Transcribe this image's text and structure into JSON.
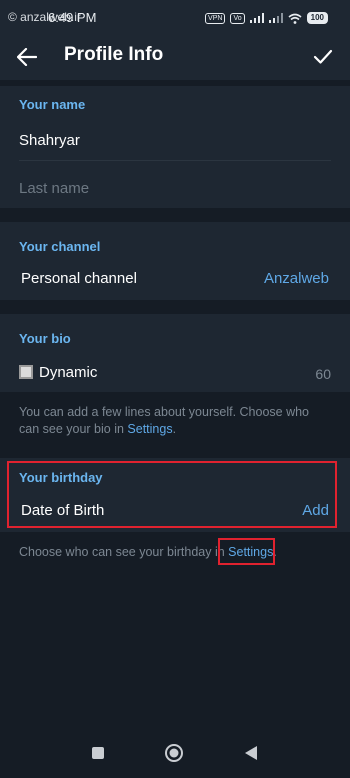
{
  "status_bar": {
    "watermark": "© anzalweb.ir",
    "time": "6:49 PM",
    "vpn": "VPN",
    "volte": "Vo",
    "battery": "100"
  },
  "top_bar": {
    "title": "Profile Info"
  },
  "name_section": {
    "header": "Your name",
    "first_name": "Shahryar",
    "last_name_placeholder": "Last name"
  },
  "channel_section": {
    "header": "Your channel",
    "label": "Personal channel",
    "value": "Anzalweb"
  },
  "bio_section": {
    "header": "Your bio",
    "bio_text": "Dynamic",
    "counter": "60",
    "hint_prefix": "You can add a few lines about yourself. Choose who can see your bio in ",
    "hint_link": "Settings",
    "hint_suffix": "."
  },
  "birthday_section": {
    "header": "Your birthday",
    "label": "Date of Birth",
    "action": "Add",
    "hint_prefix": "Choose who can see your birthday in ",
    "hint_link": "Settings",
    "hint_suffix": "."
  },
  "colors": {
    "accent": "#5fa8e6",
    "header": "#6bb6f0",
    "highlight": "#e0222f"
  }
}
